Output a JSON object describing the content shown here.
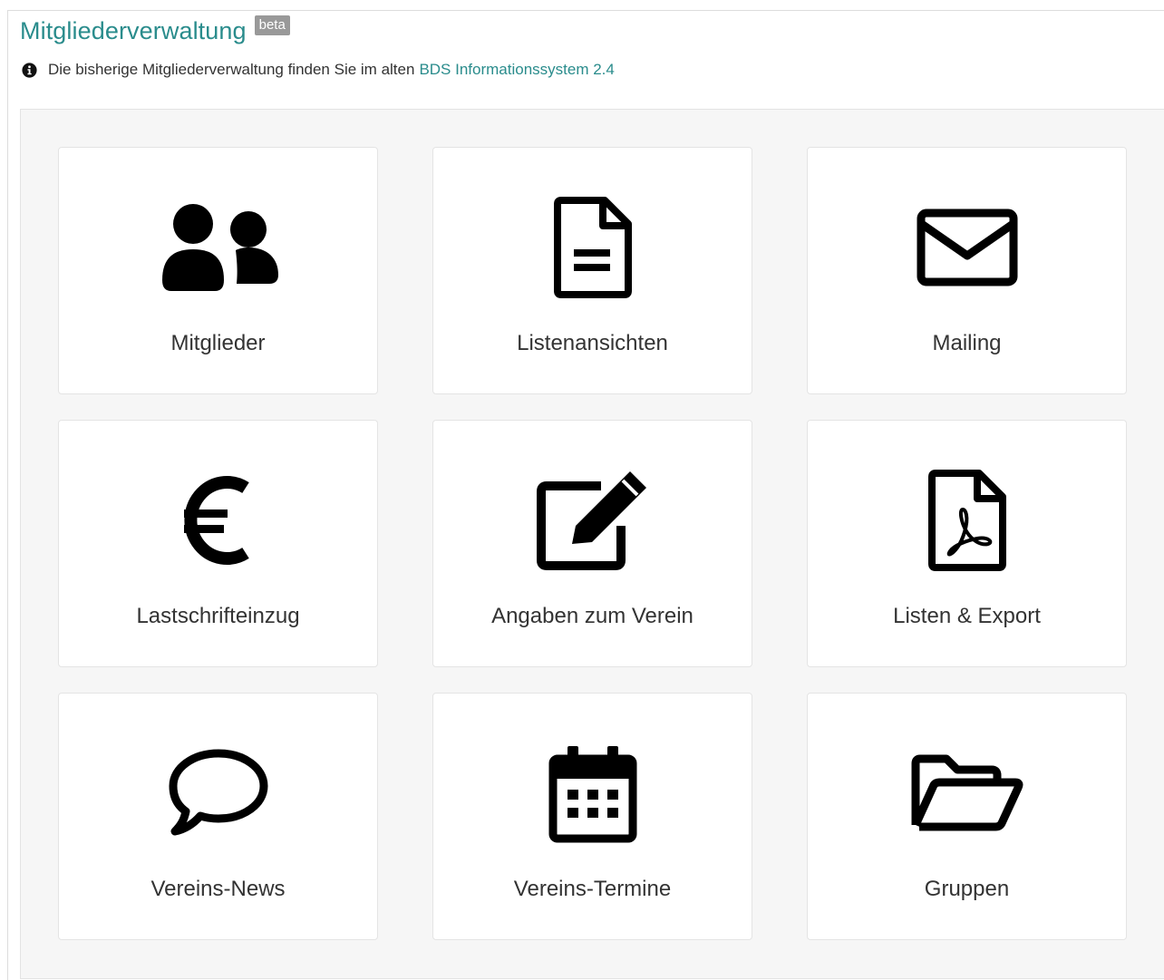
{
  "header": {
    "title": "Mitgliederverwaltung",
    "badge": "beta"
  },
  "info": {
    "icon": "info-circle-icon",
    "text": "Die bisherige Mitgliederverwaltung finden Sie im alten",
    "link_text": "BDS Informationssystem 2.4"
  },
  "tiles": [
    {
      "label": "Mitglieder",
      "icon": "users-icon"
    },
    {
      "label": "Listenansichten",
      "icon": "file-text-icon"
    },
    {
      "label": "Mailing",
      "icon": "envelope-icon"
    },
    {
      "label": "Lastschrifteinzug",
      "icon": "euro-icon"
    },
    {
      "label": "Angaben zum Verein",
      "icon": "edit-icon"
    },
    {
      "label": "Listen & Export",
      "icon": "file-pdf-icon"
    },
    {
      "label": "Vereins-News",
      "icon": "comment-icon"
    },
    {
      "label": "Vereins-Termine",
      "icon": "calendar-icon"
    },
    {
      "label": "Gruppen",
      "icon": "folder-open-icon"
    }
  ],
  "colors": {
    "accent": "#2a8c8c",
    "badge_bg": "#999999",
    "panel_bg": "#f6f6f6",
    "icon": "#000000"
  }
}
